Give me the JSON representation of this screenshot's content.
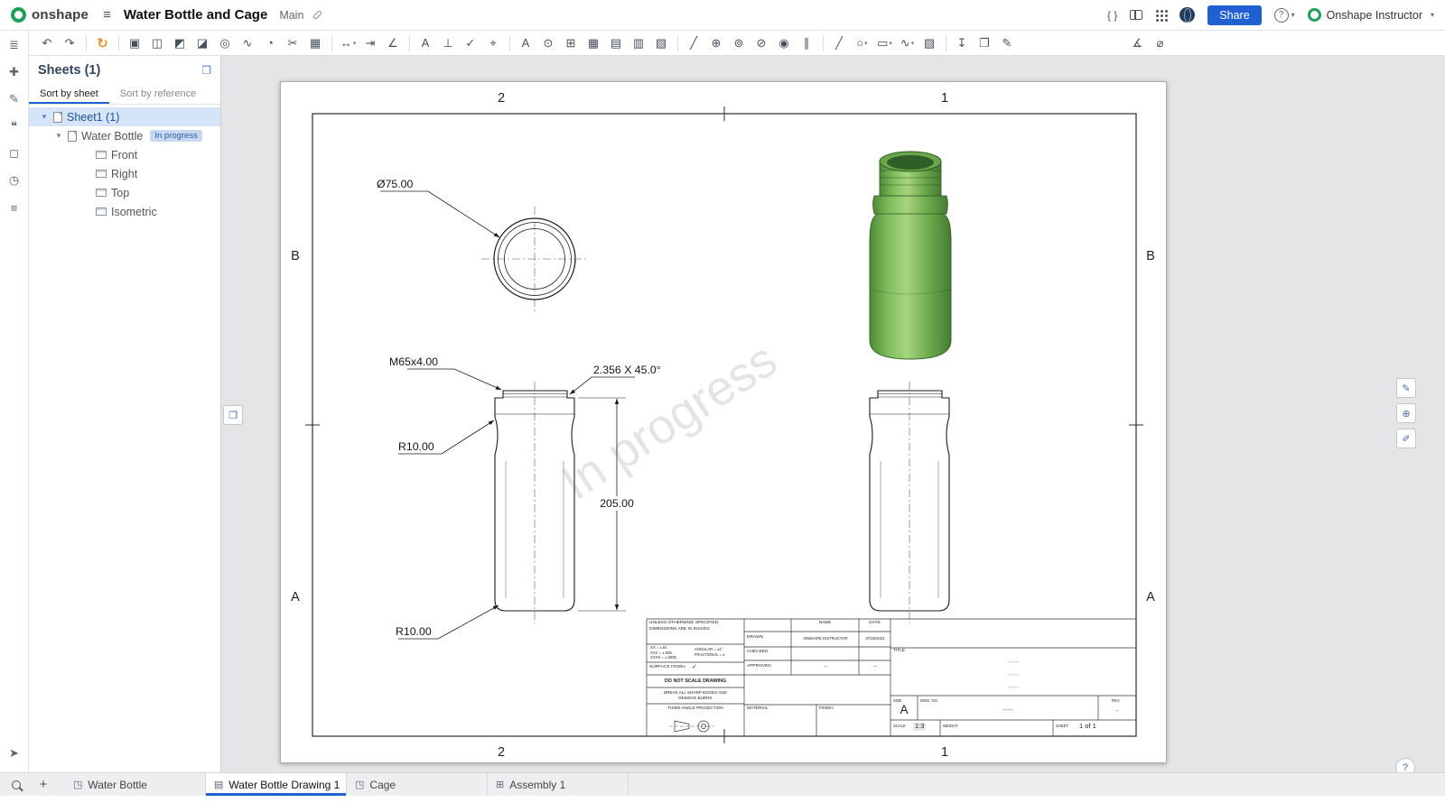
{
  "header": {
    "logo_text": "onshape",
    "menu_glyph": "≡",
    "title": "Water Bottle and Cage",
    "branch_label": "Main",
    "featurescript_glyph": "{ }",
    "share_button": "Share",
    "help_glyph": "?",
    "caret_glyph": "▾",
    "user_name": "Onshape Instructor",
    "accent_color": "#2160d0",
    "logo_color": "#1fa05a"
  },
  "toolbar": {
    "update": {
      "glyph": "↻"
    },
    "groups": [
      [
        {
          "name": "undo-button",
          "glyph": "↶"
        },
        {
          "name": "redo-button",
          "glyph": "↷"
        }
      ],
      [
        {
          "name": "insert-view-button",
          "glyph": "▣"
        },
        {
          "name": "projected-view-button",
          "glyph": "◫"
        },
        {
          "name": "auxiliary-view-button",
          "glyph": "◩"
        },
        {
          "name": "section-view-button",
          "glyph": "◪"
        },
        {
          "name": "detail-view-button",
          "glyph": "◎"
        },
        {
          "name": "broken-view-button",
          "glyph": "∿"
        },
        {
          "name": "break-out-view-button",
          "glyph": "◔"
        },
        {
          "name": "crop-view-button",
          "glyph": "✂"
        },
        {
          "name": "insert-image-button",
          "glyph": "▦"
        }
      ],
      [
        {
          "name": "dimension-button",
          "glyph": "↔",
          "caret": "▾"
        },
        {
          "name": "ordinate-dimension-button",
          "glyph": "⇥"
        },
        {
          "name": "chamfer-dimension-button",
          "glyph": "∠"
        }
      ],
      [
        {
          "name": "note-button",
          "glyph": "A"
        },
        {
          "name": "datum-button",
          "glyph": "⊥"
        },
        {
          "name": "surface-finish-button",
          "glyph": "✓"
        },
        {
          "name": "feature-control-frame-button",
          "glyph": "⌖"
        }
      ],
      [
        {
          "name": "text-button",
          "glyph": "A"
        },
        {
          "name": "find-annotation-button",
          "glyph": "⊙"
        },
        {
          "name": "table-button",
          "glyph": "⊞"
        },
        {
          "name": "hole-table-button",
          "glyph": "▦"
        },
        {
          "name": "bom-table-button",
          "glyph": "▤"
        },
        {
          "name": "revision-table-button",
          "glyph": "▥"
        },
        {
          "name": "cut-list-button",
          "glyph": "▧"
        }
      ],
      [
        {
          "name": "centerline-button",
          "glyph": "╱"
        },
        {
          "name": "center-mark-button",
          "glyph": "⊕"
        },
        {
          "name": "cosmetic-thread-button",
          "glyph": "⊚"
        },
        {
          "name": "hole-callout-button",
          "glyph": "⊘"
        },
        {
          "name": "datum-target-button",
          "glyph": "◉"
        },
        {
          "name": "parallel-lines-button",
          "glyph": "∥"
        }
      ],
      [
        {
          "name": "sketch-line-button",
          "glyph": "╱"
        },
        {
          "name": "sketch-circle-button",
          "glyph": "○",
          "caret": "▾"
        },
        {
          "name": "sketch-rectangle-button",
          "glyph": "▭",
          "caret": "▾"
        },
        {
          "name": "sketch-spline-button",
          "glyph": "∿",
          "caret": "▾"
        },
        {
          "name": "hatch-button",
          "glyph": "▨"
        }
      ],
      [
        {
          "name": "export-dxf-button",
          "glyph": "↧"
        },
        {
          "name": "snapshot-button",
          "glyph": "❐"
        },
        {
          "name": "edit-style-button",
          "glyph": "✎"
        }
      ]
    ],
    "right_icons": [
      {
        "name": "measure-button",
        "glyph": "∡"
      },
      {
        "name": "inspect-dimension-button",
        "glyph": "⌀"
      }
    ]
  },
  "left_strip": {
    "items": [
      {
        "name": "document-panel-icon",
        "glyph": "≣"
      },
      {
        "name": "transform-icon",
        "glyph": "✚"
      },
      {
        "name": "appearance-icon",
        "glyph": "✎"
      },
      {
        "name": "comment-icon",
        "glyph": "❝"
      },
      {
        "name": "parts-icon",
        "glyph": "◻"
      },
      {
        "name": "history-icon",
        "glyph": "◷"
      },
      {
        "name": "properties-icon",
        "glyph": "≡"
      }
    ],
    "bottom_item": {
      "glyph": "➤"
    }
  },
  "sheets_panel": {
    "title": "Sheets (1)",
    "dock_glyph": "❐",
    "sort_tabs": [
      {
        "label": "Sort by sheet"
      },
      {
        "label": "Sort by reference"
      }
    ],
    "sheet_row": {
      "caret": "▾",
      "label": "Sheet1 (1)"
    },
    "item_row": {
      "caret": "▾",
      "label": "Water Bottle",
      "badge": "In progress"
    },
    "views": [
      {
        "name": "view-item-front",
        "label": "Front"
      },
      {
        "name": "view-item-right",
        "label": "Right"
      },
      {
        "name": "view-item-top",
        "label": "Top"
      },
      {
        "name": "view-item-isometric",
        "label": "Isometric"
      }
    ]
  },
  "canvas": {
    "zones": {
      "top": [
        "2",
        "1"
      ],
      "bottom": [
        "2",
        "1"
      ],
      "left": [
        "B",
        "A"
      ],
      "right": [
        "B",
        "A"
      ]
    },
    "watermark": "In progress",
    "dimensions": {
      "diameter": "Ø75.00",
      "thread": "M65x4.00",
      "chamfer": "2.356 X 45.0°",
      "radius_top": "R10.00",
      "height": "205.00",
      "radius_bottom": "R10.00"
    },
    "floats": {
      "pages_glyph": "❐",
      "edit_glyph": "✎",
      "measure_glyph": "⊕",
      "tools_glyph": "✐",
      "help_glyph": "?"
    },
    "title_block": {
      "spec_line1": "UNLESS OTHERWISE SPECIFIED:",
      "spec_line2": "DIMENSIONS ARE IN INCHES",
      "tol_line1": ".XX = ±.01",
      "tol_line2": ".XXX = ±.005",
      "tol_line3": ".XXXX = ±.0005",
      "tol_angular": "ANGULAR = ±1°",
      "tol_fractional": "FRACTIONAL = ±",
      "surface_finish": "SURFACE FINISH",
      "surface_check": "✓",
      "do_not_scale": "DO NOT SCALE DRAWING",
      "break_edges_1": "BREAK ALL SHARP EDGES AND",
      "break_edges_2": "REMOVE BURRS",
      "third_angle": "THIRD ANGLE PROJECTION",
      "name_header": "NAME",
      "date_header": "DATE",
      "drawn_label": "DRAWN",
      "drawn_name": "ONSHAPE INSTRUCTOR",
      "drawn_date": "07/25/2024",
      "checked_label": "CHECKED",
      "approved_label": "APPROVED",
      "approved_name": "--",
      "approved_date": "--",
      "material_label": "MATERIAL",
      "finish_label": "FINISH",
      "title_label": "TITLE",
      "title_value_1": "----",
      "title_value_2": "----",
      "title_value_3": "----",
      "size_label": "SIZE",
      "size_value": "A",
      "dwg_label": "DWG. NO.",
      "dwg_value": "----",
      "rev_label": "REV.",
      "rev_value": "-",
      "scale_label": "SCALE",
      "scale_value": "1:3",
      "weight_label": "WEIGHT",
      "sheet_label": "SHEET",
      "sheet_value": "1 of 1"
    }
  },
  "tabs_bar": {
    "add_glyph": "+",
    "tabs": [
      {
        "label": "Water Bottle",
        "glyph": "◳"
      },
      {
        "label": "Water Bottle Drawing 1",
        "glyph": "▤"
      },
      {
        "label": "Cage",
        "glyph": "◳"
      },
      {
        "label": "Assembly 1",
        "glyph": "⊞"
      }
    ]
  }
}
